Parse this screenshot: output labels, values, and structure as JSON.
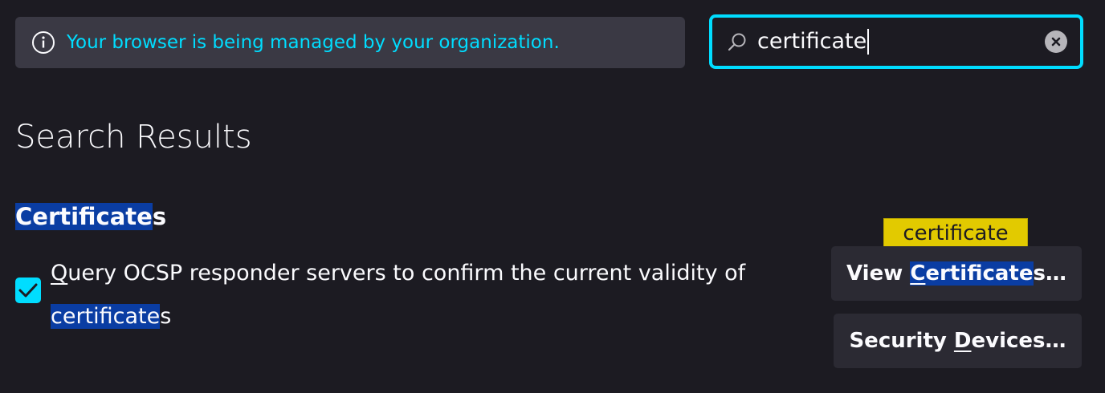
{
  "banner": {
    "text": "Your browser is being managed by your organization.",
    "icon": "info-icon"
  },
  "search": {
    "value": "certificate",
    "icons": [
      "search-icon",
      "clear-icon"
    ]
  },
  "page_title": "Search Results",
  "section": {
    "title_highlight": "Certificate",
    "title_rest": "s"
  },
  "ocsp": {
    "checked": true,
    "access_key": "Q",
    "text_part1": "uery OCSP responder servers to confirm the current validity of ",
    "highlight": "certificate",
    "text_part2": "s"
  },
  "tooltip": {
    "text": "certificate"
  },
  "buttons": {
    "view_prefix": "View ",
    "view_access_key": "C",
    "view_highlight_rest": "ertificate",
    "view_suffix": "s…",
    "sec_prefix": "Security ",
    "sec_access_key": "D",
    "sec_suffix": "evices…"
  },
  "colors": {
    "accent": "#00ddff",
    "highlight": "#0a3da3",
    "tooltip": "#e2ca00",
    "background": "#1c1b22"
  }
}
